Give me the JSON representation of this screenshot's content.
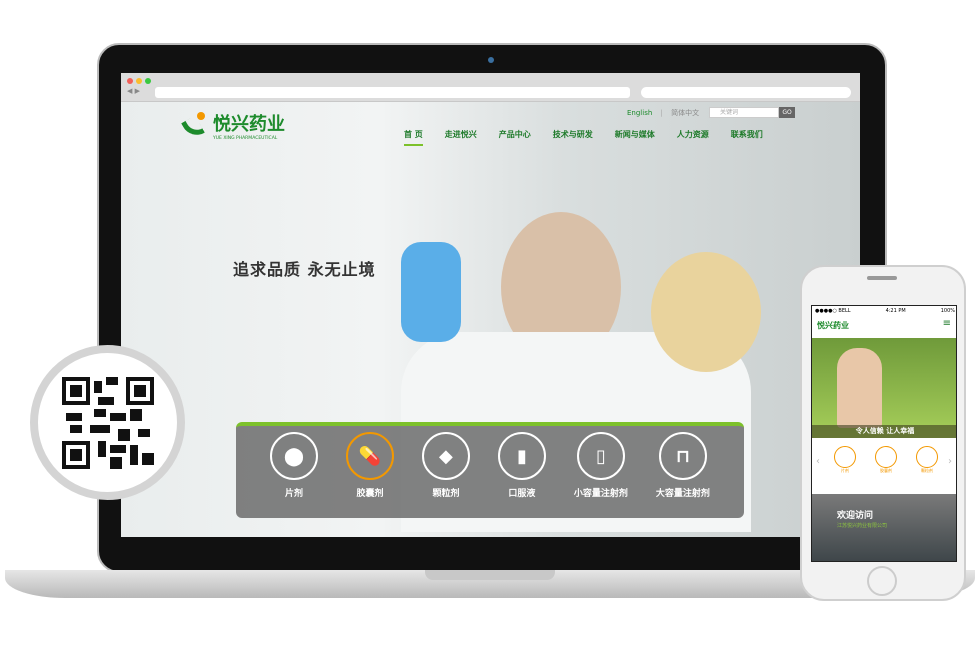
{
  "browser": {
    "url": "",
    "search": ""
  },
  "site": {
    "logo_name": "悦兴药业",
    "logo_sub": "YUE XING PHARMACEUTICAL",
    "lang_en": "English",
    "lang_sep": "|",
    "lang_cn": "简体中文",
    "search_placeholder": "关键词",
    "search_button": "GO",
    "nav": [
      "首 页",
      "走进悦兴",
      "产品中心",
      "技术与研发",
      "新闻与媒体",
      "人力资源",
      "联系我们"
    ],
    "slogan": "追求品质 永无止境",
    "categories": [
      {
        "label": "片剂",
        "icon": "tablet-icon"
      },
      {
        "label": "胶囊剂",
        "icon": "capsule-icon"
      },
      {
        "label": "颗粒剂",
        "icon": "granule-icon"
      },
      {
        "label": "口服液",
        "icon": "oral-liquid-icon"
      },
      {
        "label": "小容量注射剂",
        "icon": "ampoule-icon"
      },
      {
        "label": "大容量注射剂",
        "icon": "iv-bag-icon"
      }
    ]
  },
  "mobile": {
    "carrier": "●●●●○ BELL",
    "time": "4:21 PM",
    "battery": "100%",
    "banner_text": "令人信赖   让人幸福",
    "categories": [
      "片剂",
      "胶囊剂",
      "颗粒剂"
    ],
    "welcome": "欢迎访问",
    "company": "江苏悦兴药业有限公司"
  },
  "colors": {
    "brand_green": "#1d8b2c",
    "accent_green": "#7dc12b",
    "accent_orange": "#f39800"
  }
}
